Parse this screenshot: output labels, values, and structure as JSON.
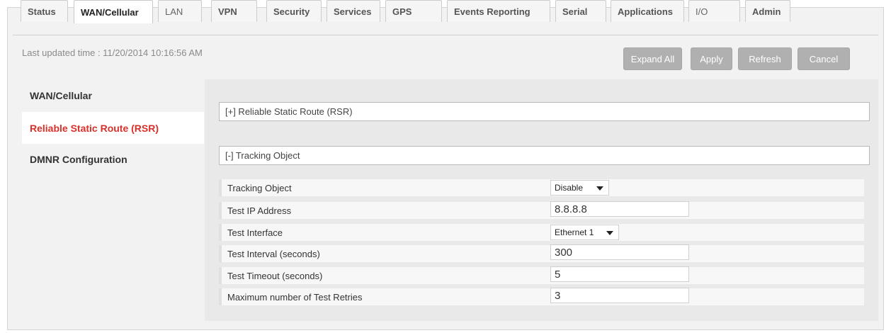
{
  "tabs": [
    {
      "label": "Status"
    },
    {
      "label": "WAN/Cellular",
      "active": true
    },
    {
      "label": "LAN"
    },
    {
      "label": "VPN"
    },
    {
      "label": "Security"
    },
    {
      "label": "Services"
    },
    {
      "label": "GPS"
    },
    {
      "label": "Events Reporting"
    },
    {
      "label": "Serial"
    },
    {
      "label": "Applications"
    },
    {
      "label": "I/O"
    },
    {
      "label": "Admin"
    }
  ],
  "header": {
    "last_updated": "Last updated time : 11/20/2014 10:16:56 AM"
  },
  "actions": {
    "expand_all": "Expand All",
    "apply": "Apply",
    "refresh": "Refresh",
    "cancel": "Cancel"
  },
  "sidebar": {
    "items": [
      {
        "label": "WAN/Cellular"
      },
      {
        "label": "Reliable Static Route (RSR)",
        "active": true
      },
      {
        "label": "DMNR Configuration"
      }
    ]
  },
  "sections": {
    "rsr": {
      "title": "[+] Reliable Static Route (RSR)"
    },
    "tracking": {
      "title": "[-] Tracking Object"
    }
  },
  "fields": {
    "tracking_object": {
      "label": "Tracking Object",
      "value": "Disable"
    },
    "test_ip": {
      "label": "Test IP Address",
      "value": "8.8.8.8"
    },
    "test_interface": {
      "label": "Test Interface",
      "value": "Ethernet 1"
    },
    "test_interval": {
      "label": "Test Interval (seconds)",
      "value": "300"
    },
    "test_timeout": {
      "label": "Test Timeout (seconds)",
      "value": "5"
    },
    "max_retries": {
      "label": "Maximum number of Test Retries",
      "value": "3"
    }
  },
  "colors": {
    "accent_red": "#d9302a",
    "button_gray": "#b0b0b0"
  },
  "icons": {
    "dropdown": "caret-down-icon"
  }
}
